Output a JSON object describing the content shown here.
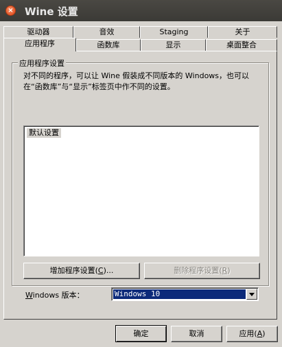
{
  "window": {
    "title": "Wine 设置",
    "close_symbol": "×"
  },
  "tabs_row1": [
    {
      "label": "驱动器"
    },
    {
      "label": "音效"
    },
    {
      "label": "Staging"
    },
    {
      "label": "关于"
    }
  ],
  "tabs_row2": [
    {
      "label": "应用程序",
      "active": true
    },
    {
      "label": "函数库"
    },
    {
      "label": "显示"
    },
    {
      "label": "桌面整合"
    }
  ],
  "app_settings": {
    "group_title": "应用程序设置",
    "description": "对不同的程序，可以让 Wine 假装成不同版本的 Windows，也可以在“函数库”与“显示”标签页中作不同的设置。",
    "list_items": [
      "默认设置"
    ],
    "add_button": {
      "pre": "增加程序设置(",
      "key": "C",
      "post": ")..."
    },
    "remove_button": {
      "pre": "删除程序设置(",
      "key": "R",
      "post": ")"
    },
    "winver_label": {
      "key": "W",
      "rest": "indows 版本："
    },
    "winver_value": "Windows 10"
  },
  "footer": {
    "ok": "确定",
    "cancel": "取消",
    "apply": {
      "pre": "应用(",
      "key": "A",
      "post": ")"
    }
  }
}
